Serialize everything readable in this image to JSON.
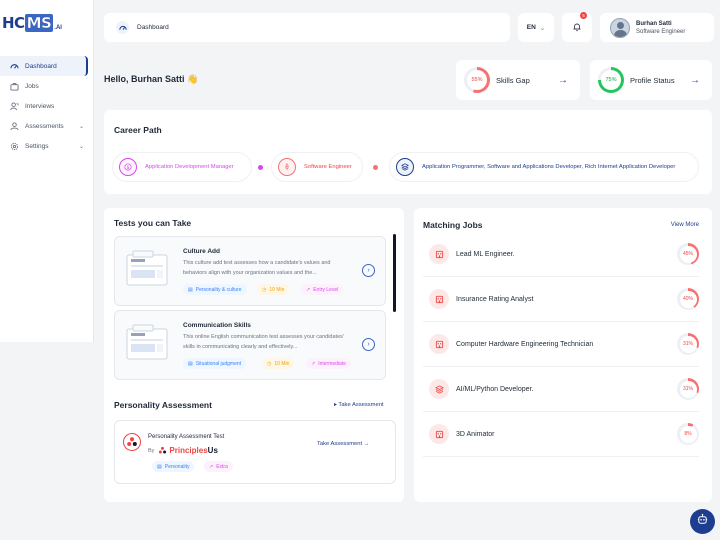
{
  "logo": {
    "hc": "HC",
    "ms": "MS",
    "ai": ".AI"
  },
  "sidebar": {
    "items": [
      {
        "label": "Dashboard",
        "icon": "dashboard-icon",
        "active": true
      },
      {
        "label": "Jobs",
        "icon": "briefcase-icon"
      },
      {
        "label": "Interviews",
        "icon": "interviews-icon"
      },
      {
        "label": "Assessments",
        "icon": "assessments-icon",
        "expandable": true
      },
      {
        "label": "Settings",
        "icon": "gear-icon",
        "expandable": true
      }
    ]
  },
  "header": {
    "breadcrumb": "Dashboard",
    "language": "EN",
    "notification_count": "5",
    "user_name": "Burhan Satti",
    "user_role": "Software Engineer"
  },
  "greeting": "Hello, Burhan Satti 👋",
  "stats": {
    "skills_gap": {
      "label": "Skills Gap",
      "value": "55%",
      "percent": 55,
      "color": "#f87171"
    },
    "profile_status": {
      "label": "Profile Status",
      "value": "75%",
      "percent": 75,
      "color": "#22c55e"
    }
  },
  "career": {
    "title": "Career Path",
    "steps": [
      {
        "label": "Application Development Manager",
        "color": "#d946ef"
      },
      {
        "label": "Software Engineer",
        "color": "#f87171"
      },
      {
        "label": "Application Programmer, Software and Applications Developer, Rich Internet Application Developer",
        "color": "#1d3d8f"
      }
    ]
  },
  "tests": {
    "title": "Tests you can Take",
    "items": [
      {
        "name": "Culture Add",
        "desc": "This culture add test assesses how a candidate's values and behaviors align with your organization values and the...",
        "tags": [
          "Personality & culture",
          "10 Min",
          "Entry Level"
        ]
      },
      {
        "name": "Communication Skills",
        "desc": "This online English communication test assesses your candidates' skills in communicating clearly and effectively...",
        "tags": [
          "Situational judgment",
          "10 Min",
          "Intermediate"
        ]
      }
    ]
  },
  "personality": {
    "title": "Personality Assessment",
    "take_label": "Take Assessment",
    "card": {
      "name": "Personality Assessment Test",
      "by": "By",
      "brand_p": "Principles",
      "brand_us": "Us",
      "take_label": "Take Assessment →",
      "tags": [
        "Personality",
        "Extra"
      ]
    }
  },
  "jobs": {
    "title": "Matching Jobs",
    "view_more": "View More",
    "items": [
      {
        "name": "Lead ML Engineer.",
        "pct": "45%",
        "value": 45
      },
      {
        "name": "Insurance Rating Analyst",
        "pct": "40%",
        "value": 40
      },
      {
        "name": "Computer Hardware Engineering Technician",
        "pct": "31%",
        "value": 31
      },
      {
        "name": "AI/ML/Python Developer.",
        "pct": "31%",
        "value": 31
      },
      {
        "name": "3D Animator",
        "pct": "8%",
        "value": 8
      }
    ]
  },
  "colors": {
    "brand": "#1d3d8f",
    "accent": "#3b66c4",
    "danger": "#ef4444",
    "success": "#22c55e",
    "magenta": "#d946ef"
  }
}
